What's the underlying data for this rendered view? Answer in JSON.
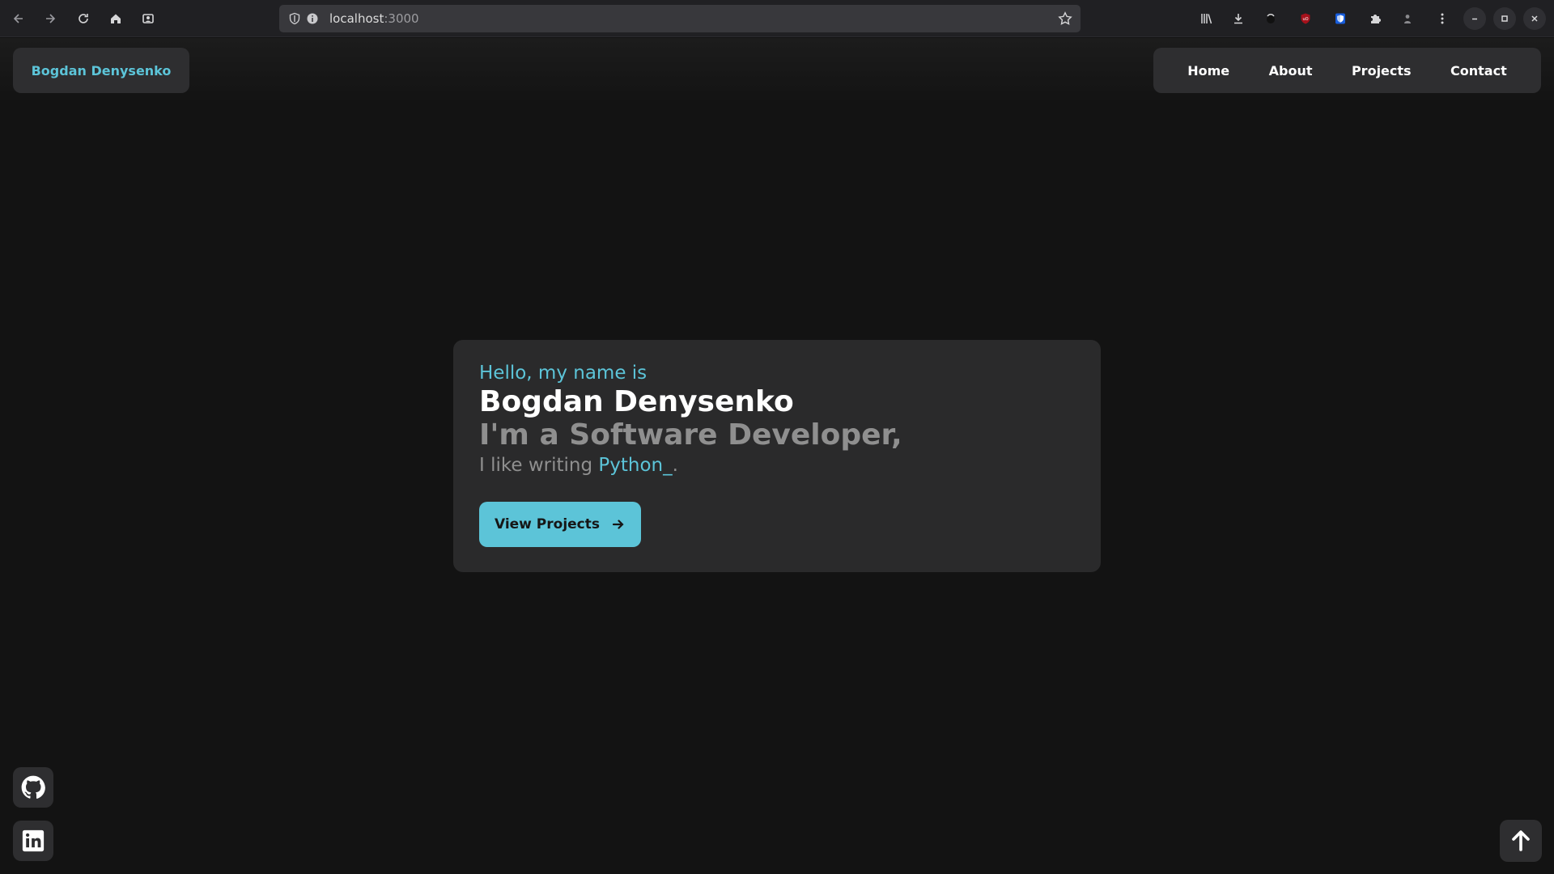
{
  "browser": {
    "url_host": "localhost",
    "url_port": ":3000"
  },
  "navbar": {
    "brand": "Bogdan Denysenko",
    "links": [
      "Home",
      "About",
      "Projects",
      "Contact"
    ]
  },
  "hero": {
    "greeting": "Hello, my name is",
    "name": "Bogdan Denysenko",
    "role": "I'm a Software Developer,",
    "like_prefix": "I like writing ",
    "like_language": "Python_",
    "like_suffix": ".",
    "cta_label": "View Projects"
  },
  "social": {
    "icons": [
      "github-icon",
      "linkedin-icon"
    ]
  },
  "colors": {
    "accent": "#5cc4d8",
    "background": "#131313",
    "card": "#2a2a2b"
  }
}
